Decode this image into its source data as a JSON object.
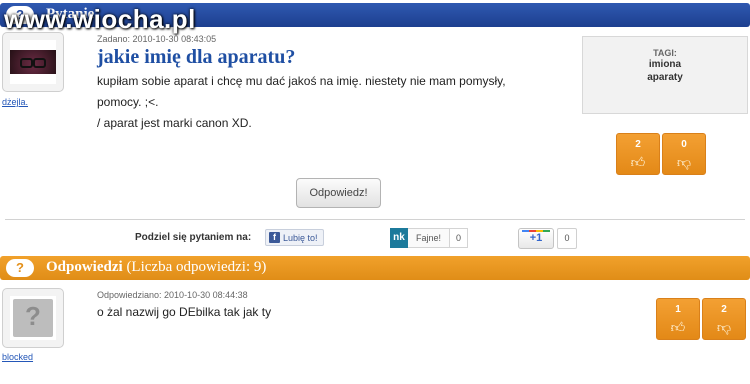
{
  "watermark": "www.wiocha.pl",
  "question_bar": {
    "icon": "?",
    "title": "Pytanie"
  },
  "question": {
    "avatar_icon": "user-avatar-photo",
    "username": "dżejla.",
    "meta": "Zadano: 2010-10-30 08:43:05",
    "title": "jakie imię dla aparatu?",
    "body_lines": [
      "kupiłam sobie aparat i chcę mu dać jakoś na imię. niestety nie mam pomysły,",
      "pomocy. ;<.",
      "/ aparat jest marki canon XD."
    ],
    "votes": {
      "up": "2",
      "down": "0"
    }
  },
  "tags": {
    "label": "TAGI:",
    "items": [
      "imiona",
      "aparaty"
    ]
  },
  "answer_button": "Odpowiedz!",
  "share": {
    "label": "Podziel się pytaniem na:",
    "facebook_letter": "f",
    "facebook_label": "Lubię to!",
    "nk_logo": "nk",
    "nk_label": "Fajne!",
    "nk_count": "0",
    "gplus_label": "+1",
    "gplus_count": "0"
  },
  "answers_bar": {
    "icon": "?",
    "title": "Odpowiedzi",
    "subtitle": "(Liczba odpowiedzi: 9)"
  },
  "answer": {
    "avatar_icon": "anonymous-avatar",
    "avatar_glyph": "?",
    "username": "blocked",
    "meta": "Odpowiedziano: 2010-10-30 08:44:38",
    "text": "o żal nazwij go DEbilka tak jak ty",
    "votes": {
      "up": "1",
      "down": "2"
    }
  },
  "colors": {
    "blue_bar": "#1d3f8f",
    "orange_bar": "#e08d17",
    "title_blue": "#1f4fa3",
    "link_blue": "#2457b8"
  }
}
